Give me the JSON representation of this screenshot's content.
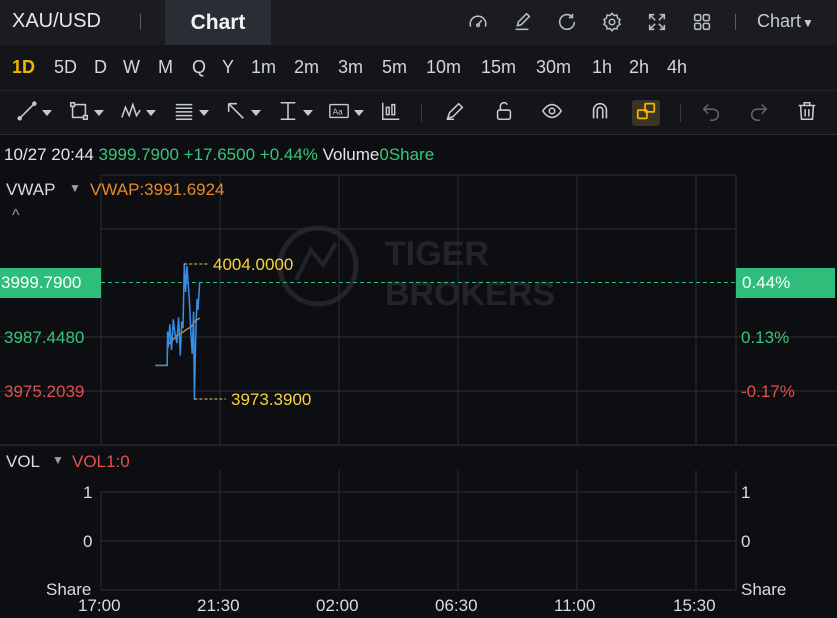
{
  "header": {
    "symbol": "XAU/USD",
    "active_tab": "Chart",
    "chart_menu_label": "Chart",
    "icons": [
      "speed-gauge-icon",
      "edit-icon",
      "refresh-icon",
      "settings-icon",
      "fullscreen-icon",
      "grid-icon"
    ]
  },
  "periods": [
    "1D",
    "5D",
    "D",
    "W",
    "M",
    "Q",
    "Y",
    "1m",
    "2m",
    "3m",
    "5m",
    "10m",
    "15m",
    "30m",
    "1h",
    "2h",
    "4h"
  ],
  "active_period": "1D",
  "drawing_tools": [
    "trend-line-icon",
    "rectangle-icon",
    "pattern-icon",
    "fibonacci-icon",
    "arrow-icon",
    "vertical-line-icon",
    "text-annotation-icon",
    "indicator-icon",
    "pen-icon",
    "unlock-icon",
    "eye-icon",
    "magnet-icon",
    "link-icon",
    "undo-icon",
    "redo-icon",
    "trash-icon"
  ],
  "info": {
    "time": "10/27 20:44",
    "price": "3999.7900",
    "change": "+17.6500",
    "change_pct": "+0.44%",
    "volume_label": "Volume",
    "volume_value": "0Share"
  },
  "main_panel": {
    "indicator": "VWAP",
    "indicator_value": "VWAP:3991.6924",
    "price_labels": {
      "current": "3999.7900",
      "mid": "3987.4480",
      "low": "3975.2039"
    },
    "pct_labels": {
      "current": "0.44%",
      "mid": "0.13%",
      "low": "-0.17%"
    },
    "high_marker": "4004.0000",
    "low_marker": "3973.3900",
    "watermark": [
      "TIGER",
      "BROKERS"
    ]
  },
  "vol_panel": {
    "indicator": "VOL",
    "indicator_value": "VOL1:0",
    "ticks": [
      "1",
      "0"
    ],
    "unit": "Share"
  },
  "x_axis": [
    "17:00",
    "21:30",
    "02:00",
    "06:30",
    "11:00",
    "15:30"
  ],
  "colors": {
    "accent": "#f7b500",
    "up": "#3cc37a",
    "down": "#e3504f",
    "price_line": "#3a8ee6",
    "vwap_line": "#d9902b",
    "current_price_bg": "#2ebd7a"
  },
  "chart_data": {
    "type": "line",
    "series": [
      {
        "name": "VWAP",
        "x": [
          "19:05",
          "19:30",
          "19:31",
          "19:40",
          "19:52",
          "20:05",
          "20:15",
          "20:25",
          "20:30",
          "20:35",
          "20:44"
        ],
        "y": [
          3981.0,
          3981.0,
          3985.7,
          3986.5,
          3987.8,
          3988.5,
          3989.2,
          3989.8,
          3990.6,
          3991.2,
          3991.7
        ]
      },
      {
        "name": "Price",
        "x": [
          "19:05",
          "19:30",
          "19:31",
          "19:33",
          "19:36",
          "19:40",
          "19:44",
          "19:48",
          "19:52",
          "19:56",
          "20:00",
          "20:03",
          "20:06",
          "20:09",
          "20:12",
          "20:15",
          "20:18",
          "20:21",
          "20:24",
          "20:27",
          "20:30",
          "20:32",
          "20:34",
          "20:36",
          "20:38",
          "20:40",
          "20:44"
        ],
        "y": [
          3981.0,
          3981.0,
          3988.5,
          3985.3,
          3990.2,
          3984.7,
          3991.3,
          3988.1,
          3986.2,
          3991.7,
          3983.4,
          3990.8,
          3989.6,
          4004.0,
          3997.8,
          4003.4,
          3999.3,
          3994.7,
          3988.3,
          3983.8,
          3993.0,
          3973.4,
          3983.2,
          3991.4,
          3995.9,
          3993.8,
          3999.8
        ]
      }
    ],
    "ylim": [
      3972.0,
      4005.0
    ],
    "xlabel": "",
    "ylabel": ""
  }
}
